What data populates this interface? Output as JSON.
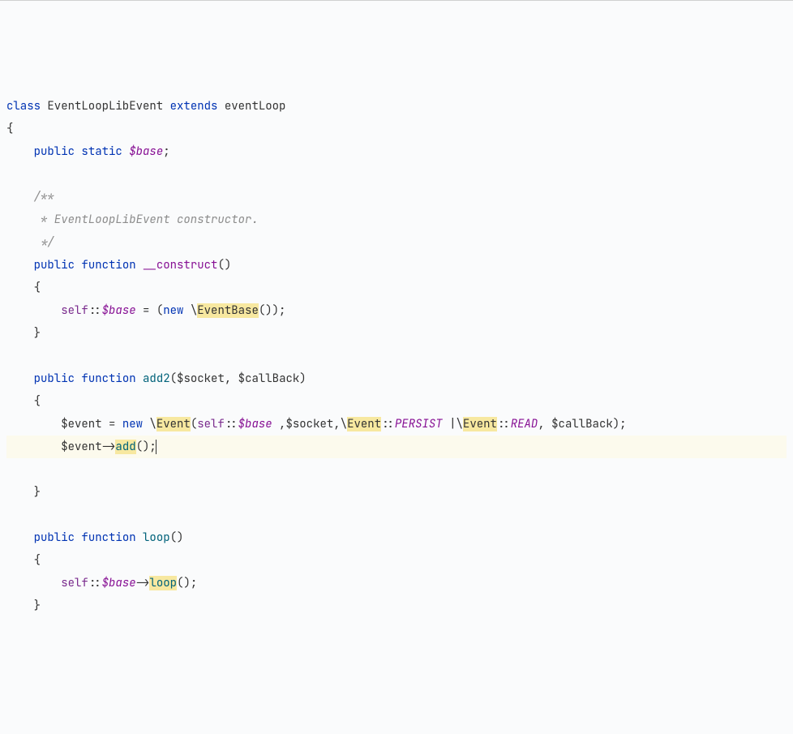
{
  "code": {
    "line1": {
      "kw_class": "class",
      "class_name": "EventLoopLibEvent",
      "kw_extends": "extends",
      "extends_name": "eventLoop"
    },
    "line2": "{",
    "line3": {
      "kw_public": "public",
      "kw_static": "static",
      "var": "$base",
      "semi": ";"
    },
    "comment1": "/**",
    "comment2": " * EventLoopLibEvent constructor.",
    "comment3": " */",
    "construct": {
      "kw_public": "public",
      "kw_function": "function",
      "name": "__construct",
      "parens": "()"
    },
    "construct_body": {
      "self": "self",
      "scope": "::",
      "base": "$base",
      "eq": " = (",
      "kw_new": "new",
      "backslash": " \\",
      "eventbase": "EventBase",
      "close": "());"
    },
    "add2": {
      "kw_public": "public",
      "kw_function": "function",
      "name": "add2",
      "open": "(",
      "socket": "$socket",
      "comma": ", ",
      "callback": "$callBack",
      "close": ")"
    },
    "add2_body1": {
      "event": "$event",
      "eq": " = ",
      "kw_new": "new",
      "backslash": " \\",
      "event_class": "Event",
      "open": "(",
      "self": "self",
      "scope": "::",
      "base": "$base",
      "c1": " ,",
      "socket": "$socket",
      "c2": ",\\",
      "event2": "Event",
      "scope2": "::",
      "persist": "PERSIST",
      "pipe": " |\\",
      "event3": "Event",
      "scope3": "::",
      "read": "READ",
      "c3": ", ",
      "callback": "$callBack",
      "close": ");"
    },
    "add2_body2": {
      "event": "$event",
      "arrow": "->",
      "add": "add",
      "close": "();"
    },
    "loop": {
      "kw_public": "public",
      "kw_function": "function",
      "name": "loop",
      "parens": "()"
    },
    "loop_body": {
      "self": "self",
      "scope": "::",
      "base": "$base",
      "arrow": "->",
      "loop": "loop",
      "close": "();"
    }
  }
}
